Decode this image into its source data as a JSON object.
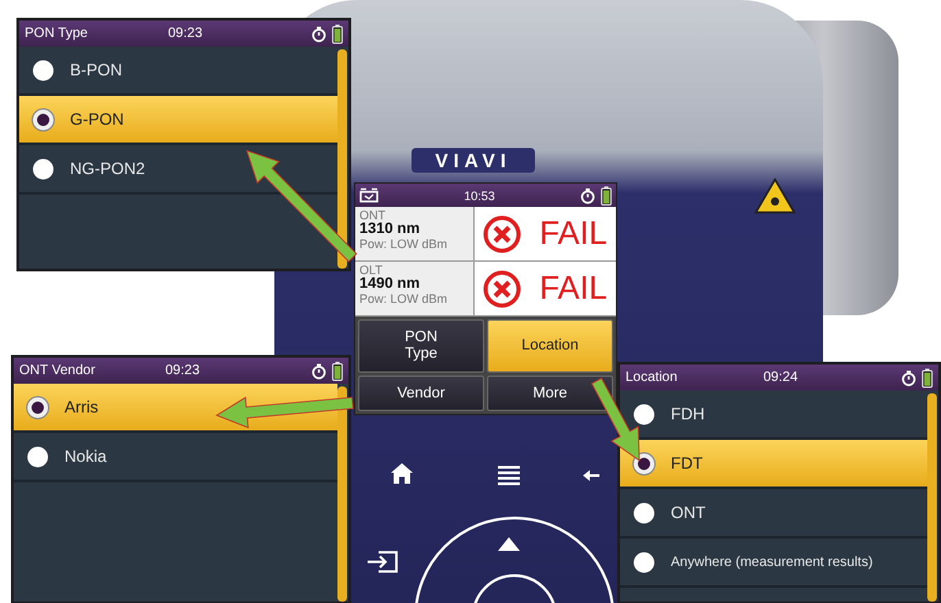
{
  "device": {
    "logo": "VIAVI",
    "screen": {
      "time": "10:53",
      "results": [
        {
          "name": "ONT",
          "wavelength": "1310 nm",
          "power": "Pow: LOW dBm",
          "verdict": "FAIL"
        },
        {
          "name": "OLT",
          "wavelength": "1490 nm",
          "power": "Pow: LOW dBm",
          "verdict": "FAIL"
        }
      ],
      "menu": [
        {
          "label": "PON Type",
          "selected": false
        },
        {
          "label": "Location",
          "selected": true
        },
        {
          "label": "Vendor",
          "selected": false
        },
        {
          "label": "More",
          "selected": false
        }
      ]
    }
  },
  "panels": [
    {
      "title": "PON Type",
      "time": "09:23",
      "items": [
        {
          "label": "B-PON",
          "selected": false
        },
        {
          "label": "G-PON",
          "selected": true
        },
        {
          "label": "NG-PON2",
          "selected": false
        }
      ]
    },
    {
      "title": "ONT Vendor",
      "time": "09:23",
      "items": [
        {
          "label": "Arris",
          "selected": true
        },
        {
          "label": "Nokia",
          "selected": false
        }
      ]
    },
    {
      "title": "Location",
      "time": "09:24",
      "items": [
        {
          "label": "FDH",
          "selected": false
        },
        {
          "label": "FDT",
          "selected": true
        },
        {
          "label": "ONT",
          "selected": false
        },
        {
          "label": "Anywhere (measurement results)",
          "selected": false
        }
      ]
    }
  ]
}
